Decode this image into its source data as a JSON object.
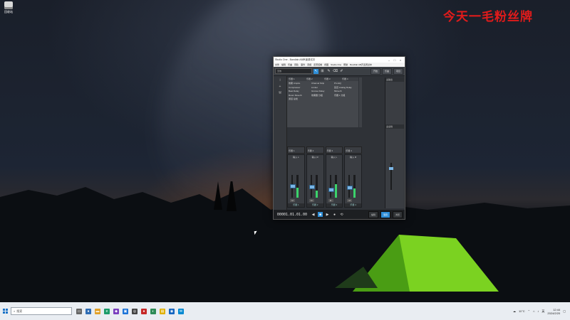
{
  "desktop": {
    "icon_label": "回收站",
    "overlay_text": "今天一毛粉丝牌"
  },
  "app": {
    "window_title": "Studio One - Bandlab AB声道调试中",
    "menu": [
      "文件",
      "编辑",
      "乐曲",
      "音轨",
      "事件",
      "音频",
      "走带控制",
      "视图",
      "Studio One",
      "帮助",
      "Bandlab AB声道调试中"
    ],
    "toolbar": {
      "dropdown_value": "无效",
      "btn_open": "开始",
      "btn_song": "乐曲",
      "btn_project": "项目"
    },
    "browser": {
      "columns": [
        "乐器 1",
        "乐器 2",
        "乐器 3",
        "乐器 4"
      ],
      "items": [
        "效果 Ampire",
        "Channel Strip",
        "Pro EQ",
        "Compressor",
        "Limiter",
        "延迟 Analog Delay",
        "Beat Delay",
        "Groove Delay",
        "Mixverb",
        "Room Reverb",
        "效果器 分组",
        "乐器 1 分组",
        "通道 总线"
      ]
    },
    "instrument_row": [
      "乐器 1",
      "乐器 2",
      "乐器 3",
      "乐器 4"
    ],
    "mixer": {
      "strips": [
        {
          "name": "输入 L",
          "fader": 0.55,
          "meter": 0.45,
          "mute": "M",
          "label": "乐器 1"
        },
        {
          "name": "输入 R",
          "fader": 0.5,
          "meter": 0.3,
          "mute": "M",
          "label": "乐器 2"
        },
        {
          "name": "输入 L",
          "fader": 0.35,
          "meter": 0.6,
          "mute": "M",
          "label": "乐器 3"
        },
        {
          "name": "输入 R",
          "fader": 0.45,
          "meter": 0.4,
          "mute": "M",
          "label": "乐器 4"
        }
      ]
    },
    "right_panel": {
      "header": "主输出",
      "sub": "主总线",
      "mute": "M"
    },
    "transport": {
      "time": "00001.01.01.00",
      "tabs": [
        "编辑",
        "混音",
        "浏览"
      ],
      "active_tab": "混音"
    }
  },
  "taskbar": {
    "search_placeholder": "搜索",
    "weather": "11°C",
    "time": "12:44",
    "date": "2024/2/20",
    "ime": "英"
  }
}
